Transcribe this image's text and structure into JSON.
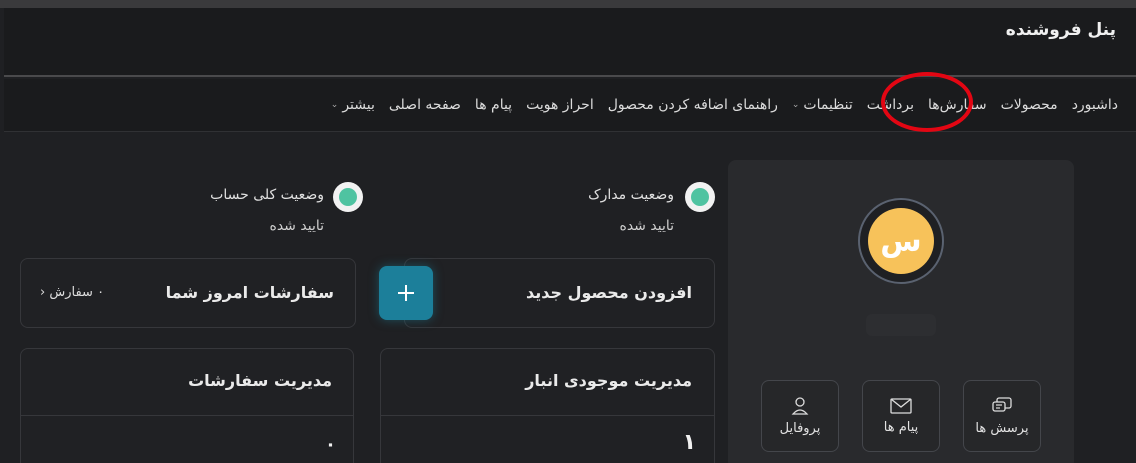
{
  "header": {
    "title": "پنل فروشنده"
  },
  "nav": {
    "items": [
      {
        "label": "داشبورد",
        "has_dropdown": false
      },
      {
        "label": "محصولات",
        "has_dropdown": false
      },
      {
        "label": "سفارش‌ها",
        "has_dropdown": false
      },
      {
        "label": "برداشت",
        "has_dropdown": false
      },
      {
        "label": "تنظیمات",
        "has_dropdown": true
      },
      {
        "label": "راهنمای اضافه کردن محصول",
        "has_dropdown": false
      },
      {
        "label": "احراز هویت",
        "has_dropdown": false
      },
      {
        "label": "پیام ها",
        "has_dropdown": false
      },
      {
        "label": "صفحه اصلی",
        "has_dropdown": false
      },
      {
        "label": "بیشتر",
        "has_dropdown": true
      }
    ],
    "highlight_color": "#e30613"
  },
  "profile": {
    "avatar_letter": "س",
    "avatar_color": "#f7c25a",
    "actions": [
      {
        "label": "پرسش ها",
        "icon": "chat-icon"
      },
      {
        "label": "پیام ها",
        "icon": "mail-icon"
      },
      {
        "label": "پروفایل",
        "icon": "user-icon"
      }
    ]
  },
  "status": {
    "documents": {
      "label": "وضعیت مدارک",
      "value": "تایید شده"
    },
    "account": {
      "label": "وضعیت کلی حساب",
      "value": "تایید شده"
    },
    "ok_color": "#4fc3a1"
  },
  "cards": {
    "add_product": {
      "title": "افزودن محصول جدید"
    },
    "today_orders": {
      "title": "سفارشات امروز شما",
      "count": "۰ سفارش"
    },
    "inventory": {
      "title": "مدیریت موجودی انبار",
      "value": "۱"
    },
    "orders_mgmt": {
      "title": "مدیریت سفارشات",
      "value": "۰"
    }
  },
  "accent_color": "#1c7f9a"
}
